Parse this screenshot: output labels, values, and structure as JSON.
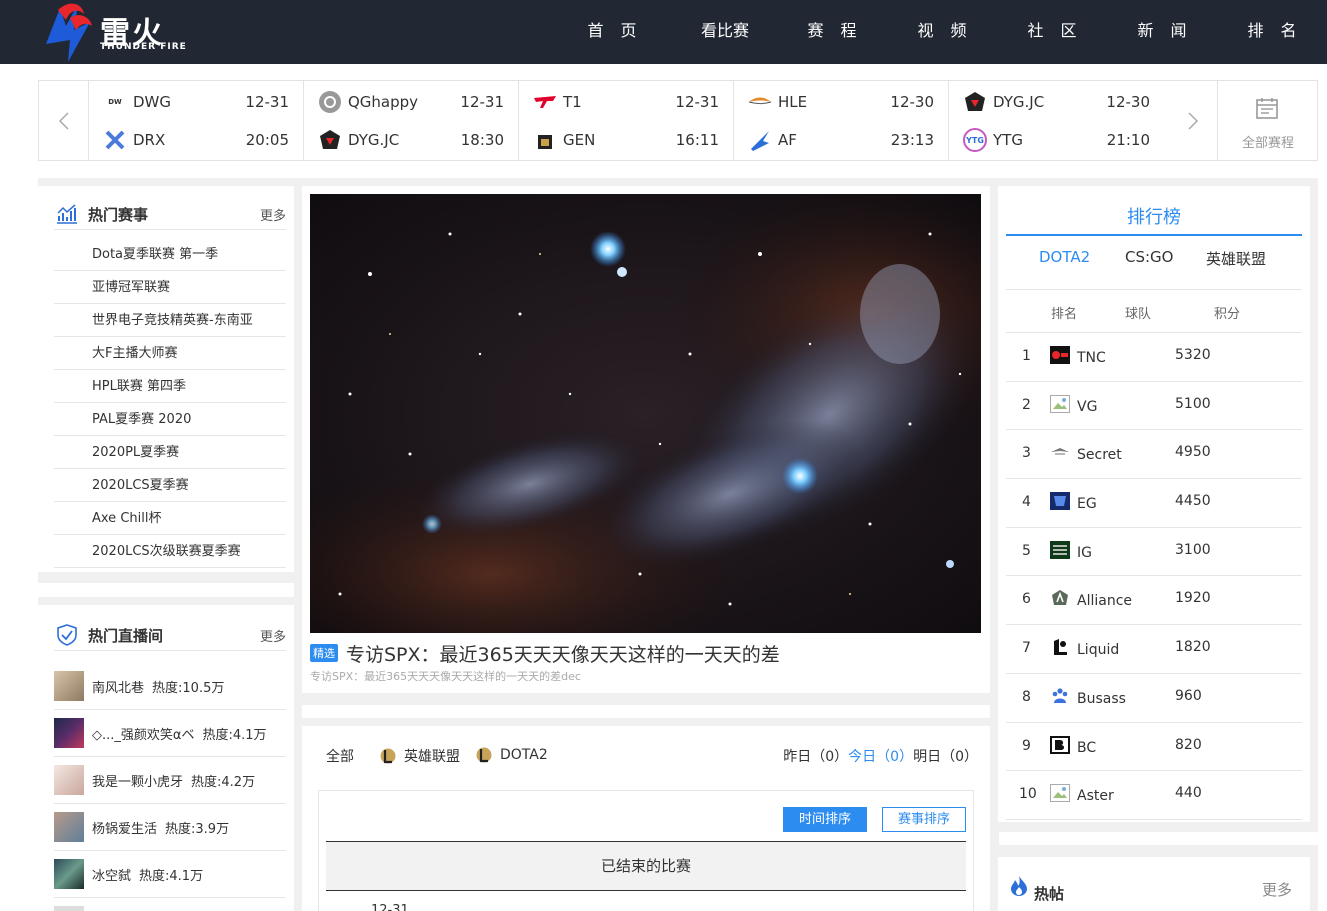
{
  "colors": {
    "header_bg": "#222833",
    "accent": "#2d8cf0",
    "panel_bg": "#f0f0f0"
  },
  "logo": {
    "cn": "雷火",
    "en": "THUNDER FIRE"
  },
  "nav": [
    "首 页",
    "看比赛",
    "赛 程",
    "视 频",
    "社 区",
    "新 闻",
    "排 名"
  ],
  "schedule": {
    "prev_icon": "chevron-left-icon",
    "next_icon": "chevron-right-icon",
    "all_label": "全部赛程",
    "matches": [
      {
        "team1": "DWG",
        "team2": "DRX",
        "date": "12-31",
        "time": "20:05"
      },
      {
        "team1": "QGhappy",
        "team2": "DYG.JC",
        "date": "12-31",
        "time": "18:30"
      },
      {
        "team1": "T1",
        "team2": "GEN",
        "date": "12-31",
        "time": "16:11"
      },
      {
        "team1": "HLE",
        "team2": "AF",
        "date": "12-30",
        "time": "23:13"
      },
      {
        "team1": "DYG.JC",
        "team2": "YTG",
        "date": "12-30",
        "time": "21:10"
      }
    ]
  },
  "hot_events": {
    "title": "热门赛事",
    "more": "更多",
    "items": [
      "Dota夏季联赛 第一季",
      "亚博冠军联赛",
      "世界电子竞技精英赛-东南亚",
      "大F主播大师赛",
      "HPL联赛 第四季",
      "PAL夏季赛 2020",
      "2020PL夏季赛",
      "2020LCS夏季赛",
      "Axe Chill杯",
      "2020LCS次级联赛夏季赛"
    ]
  },
  "hot_live": {
    "title": "热门直播间",
    "more": "更多",
    "heat_prefix": "热度:",
    "items": [
      {
        "name": "南风北巷",
        "heat": "10.5万"
      },
      {
        "name": "◇..._强颜欢笑αベ",
        "heat": "4.1万"
      },
      {
        "name": "我是一颗小虎牙",
        "heat": "4.2万"
      },
      {
        "name": "杨锅爱生活",
        "heat": "3.9万"
      },
      {
        "name": "冰空弑",
        "heat": "4.1万"
      }
    ]
  },
  "feature": {
    "tag": "精选",
    "title": "专访SPX：最近365天天天像天天这样的一天天的差",
    "subtitle": "专访SPX：最近365天天天像天天这样的一天天的差dec"
  },
  "match_filters": {
    "all": "全部",
    "games": [
      "英雄联盟",
      "DOTA2"
    ],
    "yesterday": "昨日（0）",
    "today": "今日（0）",
    "tomorrow": "明日（0）"
  },
  "match_list": {
    "sort_time": "时间排序",
    "sort_event": "赛事排序",
    "ended": "已结束的比赛",
    "first_date": "12-31"
  },
  "ranking": {
    "title": "排行榜",
    "tabs": [
      "DOTA2",
      "CS:GO",
      "英雄联盟"
    ],
    "headers": [
      "排名",
      "球队",
      "积分"
    ],
    "rows": [
      {
        "rank": "1",
        "team": "TNC",
        "score": "5320"
      },
      {
        "rank": "2",
        "team": "VG",
        "score": "5100"
      },
      {
        "rank": "3",
        "team": "Secret",
        "score": "4950"
      },
      {
        "rank": "4",
        "team": "EG",
        "score": "4450"
      },
      {
        "rank": "5",
        "team": "IG",
        "score": "3100"
      },
      {
        "rank": "6",
        "team": "Alliance",
        "score": "1920"
      },
      {
        "rank": "7",
        "team": "Liquid",
        "score": "1820"
      },
      {
        "rank": "8",
        "team": "Busass",
        "score": "960"
      },
      {
        "rank": "9",
        "team": "BC",
        "score": "820"
      },
      {
        "rank": "10",
        "team": "Aster",
        "score": "440"
      }
    ]
  },
  "hot_posts": {
    "title": "热帖",
    "more": "更多"
  }
}
